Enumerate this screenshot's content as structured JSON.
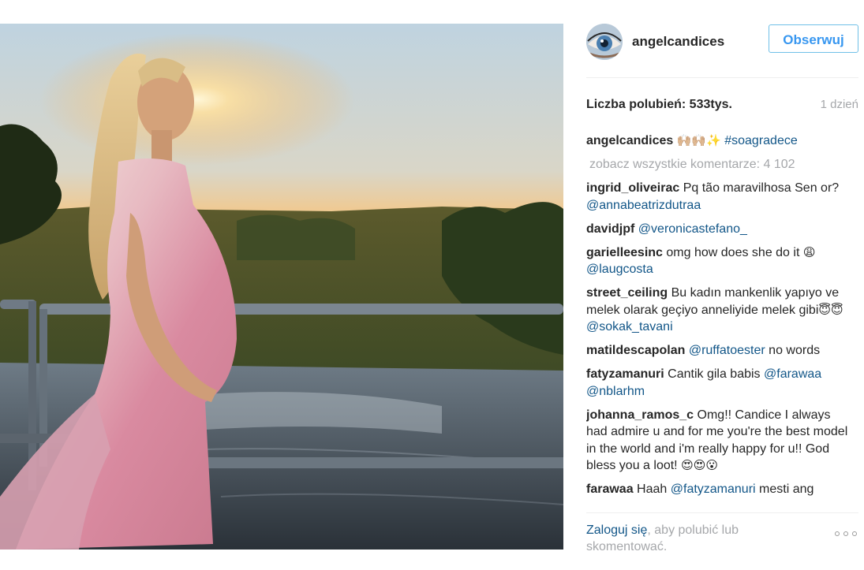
{
  "post": {
    "image_alt": "Pregnant woman in a long pink tie-dye dress standing on a bridge at sunset over a river"
  },
  "header": {
    "username": "angelcandices",
    "follow_label": "Obserwuj"
  },
  "stats": {
    "likes": "Liczba polubień: 533tys.",
    "time_ago": "1 dzień"
  },
  "caption": {
    "user": "angelcandices",
    "emoji": "🙌🏼🙌🏼✨",
    "hashtag": "#soagradece"
  },
  "view_all_comments": "zobacz wszystkie komentarze: 4 102",
  "comments": [
    {
      "user": "ingrid_oliveirac",
      "text": "Pq tão maravilhosa Sen or?",
      "mention": "@annabeatrizdutraa"
    },
    {
      "user": "davidjpf",
      "mention": "@veronicastefano_"
    },
    {
      "user": "garielleesinc",
      "text": "omg how does she do it",
      "emoji": "😩",
      "mention": "@laugcosta"
    },
    {
      "user": "street_ceiling",
      "text": "Bu kadın mankenlik yapıyo ve melek olarak geçiyo anneliyide melek gibi",
      "emoji": "😇😇",
      "mention": "@sokak_tavani"
    },
    {
      "user": "matildescapolan",
      "mention": "@ruffatoester",
      "text_after": "no words"
    },
    {
      "user": "fatyzamanuri",
      "text": "Cantik gila babis",
      "mention": "@farawaa",
      "mention2": "@nblarhm"
    },
    {
      "user": "johanna_ramos_c",
      "text": "Omg!! Candice I always had admire u and for me you're the best model in the world and i'm really happy for u!! God bless you a loot!",
      "emoji": "😍😍😮"
    },
    {
      "user": "farawaa",
      "text": "Haah",
      "mention": "@fatyzamanuri",
      "text_after": "mesti ang"
    }
  ],
  "footer": {
    "login_link": "Zaloguj się",
    "login_rest": ", aby polubić lub skomentować."
  },
  "colors": {
    "follow_blue": "#3897f0",
    "mention_blue": "#125688",
    "muted_gray": "#a5a7aa",
    "text_dark": "#262626"
  },
  "icons": {
    "more": "more-options-icon"
  }
}
